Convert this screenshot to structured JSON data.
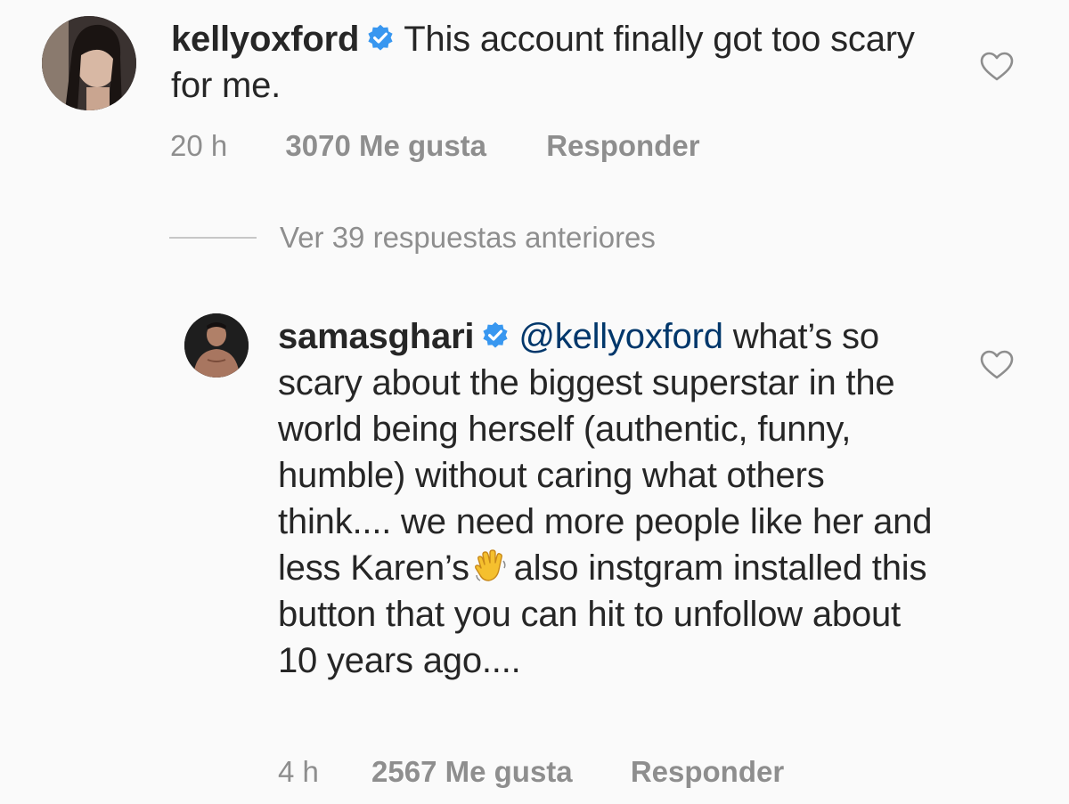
{
  "comments": [
    {
      "username": "kellyoxford",
      "text": "This account finally got too scary for me.",
      "time": "20 h",
      "likes": "3070 Me gusta",
      "reply": "Responder"
    },
    {
      "username": "samasghari",
      "mention": "@kellyoxford",
      "text_before_emoji": "what’s so scary about the biggest superstar in the world being herself (authentic, funny, humble) without caring what others think.... we need more people like her and less Karen’s",
      "emoji_icon": "waving-hand-icon",
      "text_after_emoji": "also instgram installed this button that you can hit to unfollow about 10 years ago....",
      "time": "4 h",
      "likes": "2567 Me gusta",
      "reply": "Responder"
    }
  ],
  "view_replies": "Ver 39 respuestas anteriores",
  "colors": {
    "verified": "#3897f0",
    "mention": "#00376b",
    "meta": "#8e8e8e",
    "background": "#fafafa"
  }
}
